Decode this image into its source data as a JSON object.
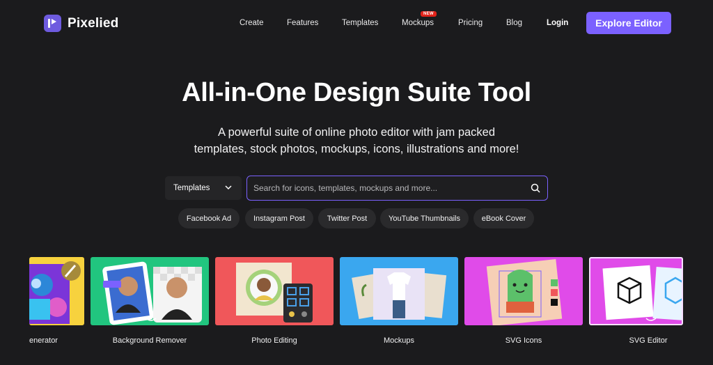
{
  "header": {
    "logo_text": "Pixelied",
    "nav": [
      "Create",
      "Features",
      "Templates",
      "Mockups",
      "Pricing",
      "Blog"
    ],
    "new_badge": "NEW",
    "login": "Login",
    "cta": "Explore Editor"
  },
  "hero": {
    "title": "All-in-One Design Suite Tool",
    "subtitle_line1": "A powerful suite of online photo editor with jam packed",
    "subtitle_line2": "templates, stock photos, mockups, icons, illustrations and more!"
  },
  "search": {
    "category": "Templates",
    "placeholder": "Search for icons, templates, mockups and more..."
  },
  "chips": [
    "Facebook Ad",
    "Instagram Post",
    "Twitter Post",
    "YouTube Thumbnails",
    "eBook Cover"
  ],
  "cards": [
    {
      "label": "enerator",
      "color": "#f7d23e"
    },
    {
      "label": "Background Remover",
      "color": "#21c57f"
    },
    {
      "label": "Photo Editing",
      "color": "#f0575a"
    },
    {
      "label": "Mockups",
      "color": "#3aa7ef"
    },
    {
      "label": "SVG Icons",
      "color": "#e04be9"
    },
    {
      "label": "SVG Editor",
      "color": "#e04be9"
    }
  ],
  "colors": {
    "accent": "#7b61ff",
    "background": "#1b1b1d"
  }
}
